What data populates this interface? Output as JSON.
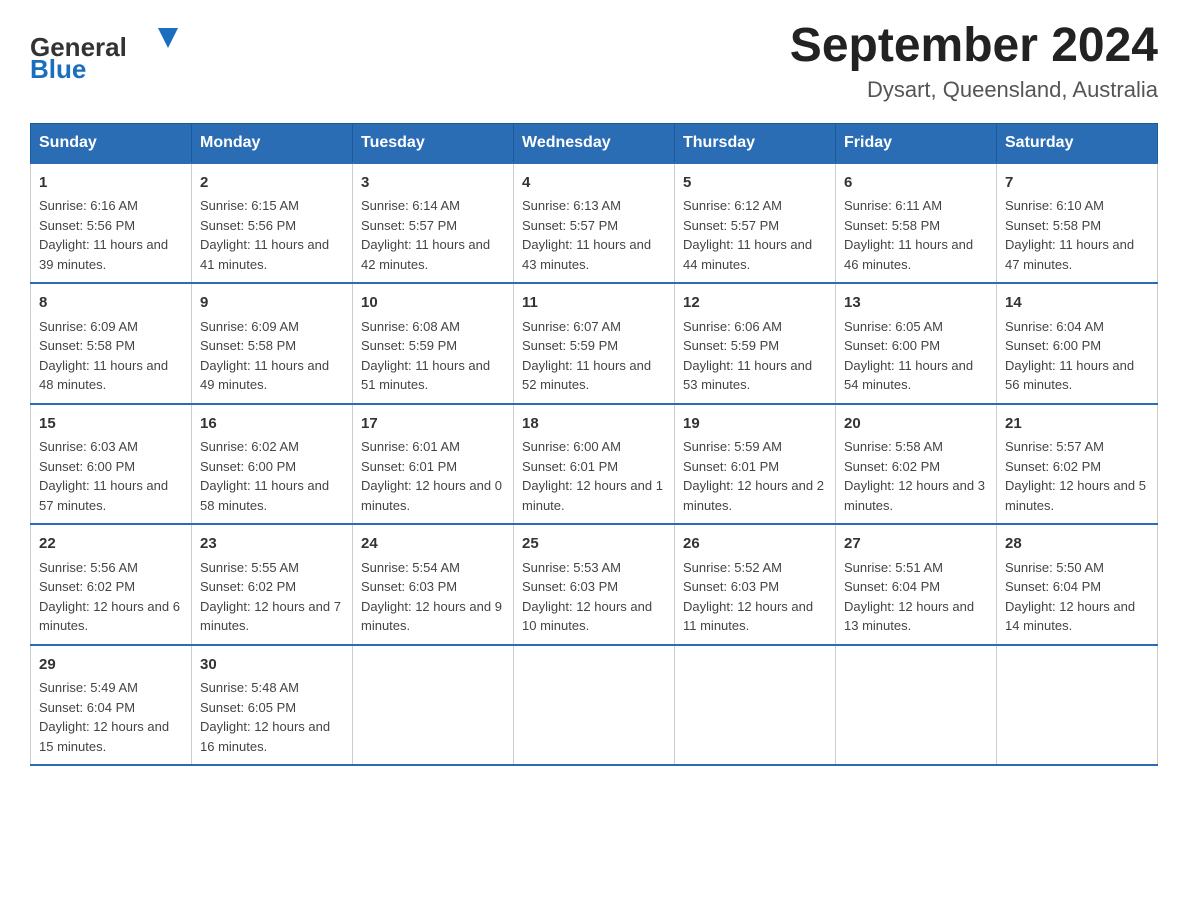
{
  "header": {
    "logo": {
      "general": "General",
      "blue": "Blue"
    },
    "title": "September 2024",
    "subtitle": "Dysart, Queensland, Australia"
  },
  "days_of_week": [
    "Sunday",
    "Monday",
    "Tuesday",
    "Wednesday",
    "Thursday",
    "Friday",
    "Saturday"
  ],
  "weeks": [
    [
      {
        "day": "1",
        "sunrise": "6:16 AM",
        "sunset": "5:56 PM",
        "daylight": "11 hours and 39 minutes."
      },
      {
        "day": "2",
        "sunrise": "6:15 AM",
        "sunset": "5:56 PM",
        "daylight": "11 hours and 41 minutes."
      },
      {
        "day": "3",
        "sunrise": "6:14 AM",
        "sunset": "5:57 PM",
        "daylight": "11 hours and 42 minutes."
      },
      {
        "day": "4",
        "sunrise": "6:13 AM",
        "sunset": "5:57 PM",
        "daylight": "11 hours and 43 minutes."
      },
      {
        "day": "5",
        "sunrise": "6:12 AM",
        "sunset": "5:57 PM",
        "daylight": "11 hours and 44 minutes."
      },
      {
        "day": "6",
        "sunrise": "6:11 AM",
        "sunset": "5:58 PM",
        "daylight": "11 hours and 46 minutes."
      },
      {
        "day": "7",
        "sunrise": "6:10 AM",
        "sunset": "5:58 PM",
        "daylight": "11 hours and 47 minutes."
      }
    ],
    [
      {
        "day": "8",
        "sunrise": "6:09 AM",
        "sunset": "5:58 PM",
        "daylight": "11 hours and 48 minutes."
      },
      {
        "day": "9",
        "sunrise": "6:09 AM",
        "sunset": "5:58 PM",
        "daylight": "11 hours and 49 minutes."
      },
      {
        "day": "10",
        "sunrise": "6:08 AM",
        "sunset": "5:59 PM",
        "daylight": "11 hours and 51 minutes."
      },
      {
        "day": "11",
        "sunrise": "6:07 AM",
        "sunset": "5:59 PM",
        "daylight": "11 hours and 52 minutes."
      },
      {
        "day": "12",
        "sunrise": "6:06 AM",
        "sunset": "5:59 PM",
        "daylight": "11 hours and 53 minutes."
      },
      {
        "day": "13",
        "sunrise": "6:05 AM",
        "sunset": "6:00 PM",
        "daylight": "11 hours and 54 minutes."
      },
      {
        "day": "14",
        "sunrise": "6:04 AM",
        "sunset": "6:00 PM",
        "daylight": "11 hours and 56 minutes."
      }
    ],
    [
      {
        "day": "15",
        "sunrise": "6:03 AM",
        "sunset": "6:00 PM",
        "daylight": "11 hours and 57 minutes."
      },
      {
        "day": "16",
        "sunrise": "6:02 AM",
        "sunset": "6:00 PM",
        "daylight": "11 hours and 58 minutes."
      },
      {
        "day": "17",
        "sunrise": "6:01 AM",
        "sunset": "6:01 PM",
        "daylight": "12 hours and 0 minutes."
      },
      {
        "day": "18",
        "sunrise": "6:00 AM",
        "sunset": "6:01 PM",
        "daylight": "12 hours and 1 minute."
      },
      {
        "day": "19",
        "sunrise": "5:59 AM",
        "sunset": "6:01 PM",
        "daylight": "12 hours and 2 minutes."
      },
      {
        "day": "20",
        "sunrise": "5:58 AM",
        "sunset": "6:02 PM",
        "daylight": "12 hours and 3 minutes."
      },
      {
        "day": "21",
        "sunrise": "5:57 AM",
        "sunset": "6:02 PM",
        "daylight": "12 hours and 5 minutes."
      }
    ],
    [
      {
        "day": "22",
        "sunrise": "5:56 AM",
        "sunset": "6:02 PM",
        "daylight": "12 hours and 6 minutes."
      },
      {
        "day": "23",
        "sunrise": "5:55 AM",
        "sunset": "6:02 PM",
        "daylight": "12 hours and 7 minutes."
      },
      {
        "day": "24",
        "sunrise": "5:54 AM",
        "sunset": "6:03 PM",
        "daylight": "12 hours and 9 minutes."
      },
      {
        "day": "25",
        "sunrise": "5:53 AM",
        "sunset": "6:03 PM",
        "daylight": "12 hours and 10 minutes."
      },
      {
        "day": "26",
        "sunrise": "5:52 AM",
        "sunset": "6:03 PM",
        "daylight": "12 hours and 11 minutes."
      },
      {
        "day": "27",
        "sunrise": "5:51 AM",
        "sunset": "6:04 PM",
        "daylight": "12 hours and 13 minutes."
      },
      {
        "day": "28",
        "sunrise": "5:50 AM",
        "sunset": "6:04 PM",
        "daylight": "12 hours and 14 minutes."
      }
    ],
    [
      {
        "day": "29",
        "sunrise": "5:49 AM",
        "sunset": "6:04 PM",
        "daylight": "12 hours and 15 minutes."
      },
      {
        "day": "30",
        "sunrise": "5:48 AM",
        "sunset": "6:05 PM",
        "daylight": "12 hours and 16 minutes."
      },
      null,
      null,
      null,
      null,
      null
    ]
  ],
  "labels": {
    "sunrise": "Sunrise:",
    "sunset": "Sunset:",
    "daylight": "Daylight:"
  }
}
